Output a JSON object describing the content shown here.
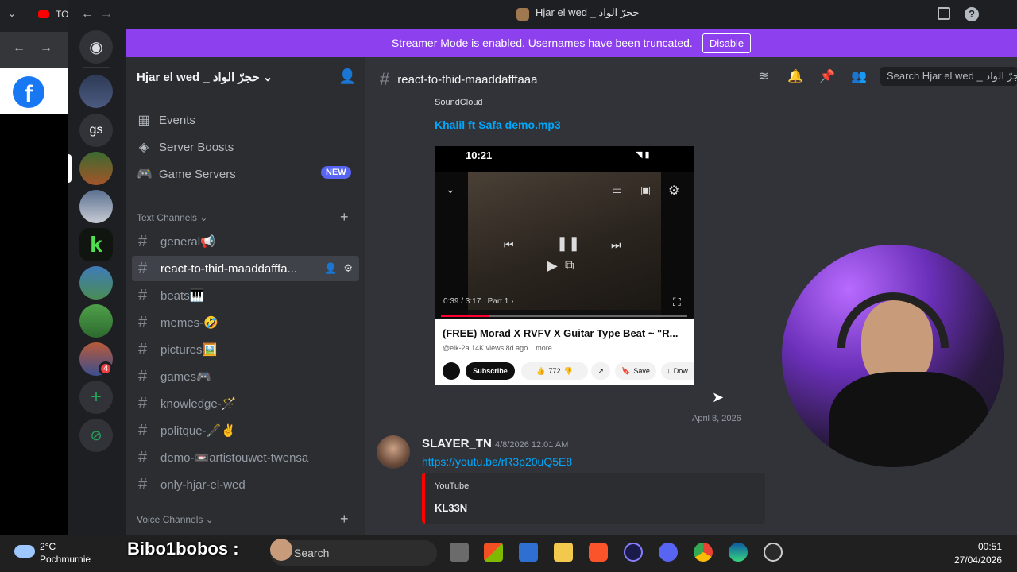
{
  "browser": {
    "tab_text": "TO"
  },
  "titlebar": {
    "title": "Hjar el wed _ حجرّ الواد",
    "back_icon": "arrow-left-icon",
    "forward_icon": "arrow-right-icon"
  },
  "banner": {
    "text": "Streamer Mode is enabled. Usernames have been truncated.",
    "button": "Disable"
  },
  "servers": [
    {
      "name": "server-avatar-1"
    },
    {
      "name": "gs",
      "label": "gs"
    },
    {
      "name": "server-avatar-3"
    },
    {
      "name": "server-avatar-4"
    },
    {
      "name": "server-avatar-5"
    },
    {
      "name": "server-avatar-6"
    },
    {
      "name": "server-avatar-7"
    },
    {
      "name": "server-avatar-8",
      "badge": "4"
    }
  ],
  "sidebar": {
    "server_name": "Hjar el wed _ حجرّ الواد",
    "events": "Events",
    "boosts": "Server Boosts",
    "game_servers": "Game Servers",
    "new_badge": "NEW",
    "text_category": "Text Channels",
    "voice_category": "Voice Channels",
    "channels": [
      {
        "name": "general📢"
      },
      {
        "name": "react-to-thid-maaddafffa..."
      },
      {
        "name": "beats🎹"
      },
      {
        "name": "memes-🤣"
      },
      {
        "name": "pictures🖼️"
      },
      {
        "name": "games🎮"
      },
      {
        "name": "knowledge-🪄"
      },
      {
        "name": "politque-🖋️✌️"
      },
      {
        "name": "demo-📼artistouwet-twensa"
      },
      {
        "name": "only-hjar-el-wed"
      }
    ]
  },
  "chat": {
    "channel_title": "react-to-thid-maaddafffaaa",
    "search_placeholder": "Search Hjar el wed _ حجرّ الواد",
    "soundcloud_label": "SoundCloud",
    "soundcloud_link": "Khalil ft Safa demo.mp3",
    "video": {
      "clock": "10:21",
      "time": "0:39 / 3:17",
      "part": "Part 1",
      "title": "(FREE) Morad X RVFV X Guitar Type Beat ~ \"R...",
      "meta": "@elk-2a  14K views  8d ago  ...more",
      "subscribe": "Subscribe",
      "likes": "772",
      "save": "Save",
      "download": "Dow"
    },
    "date_separator": "April 8, 2026",
    "message": {
      "author": "SLAYER_TN",
      "time": "4/8/2026 12:01 AM",
      "link": "https://youtu.be/rR3p20uQ5E8",
      "embed_provider": "YouTube",
      "embed_title": "KL33N"
    }
  },
  "taskbar": {
    "temp": "2°C",
    "weather": "Pochmurnie",
    "overlay_name": "Bibo1bobos :",
    "search": "Search",
    "time": "00:51",
    "date": "27/04/2026"
  },
  "colors": {
    "banner": "#8d40ed",
    "blurple": "#5865f2",
    "link": "#00a8fc",
    "youtube_red": "#ff0000"
  }
}
